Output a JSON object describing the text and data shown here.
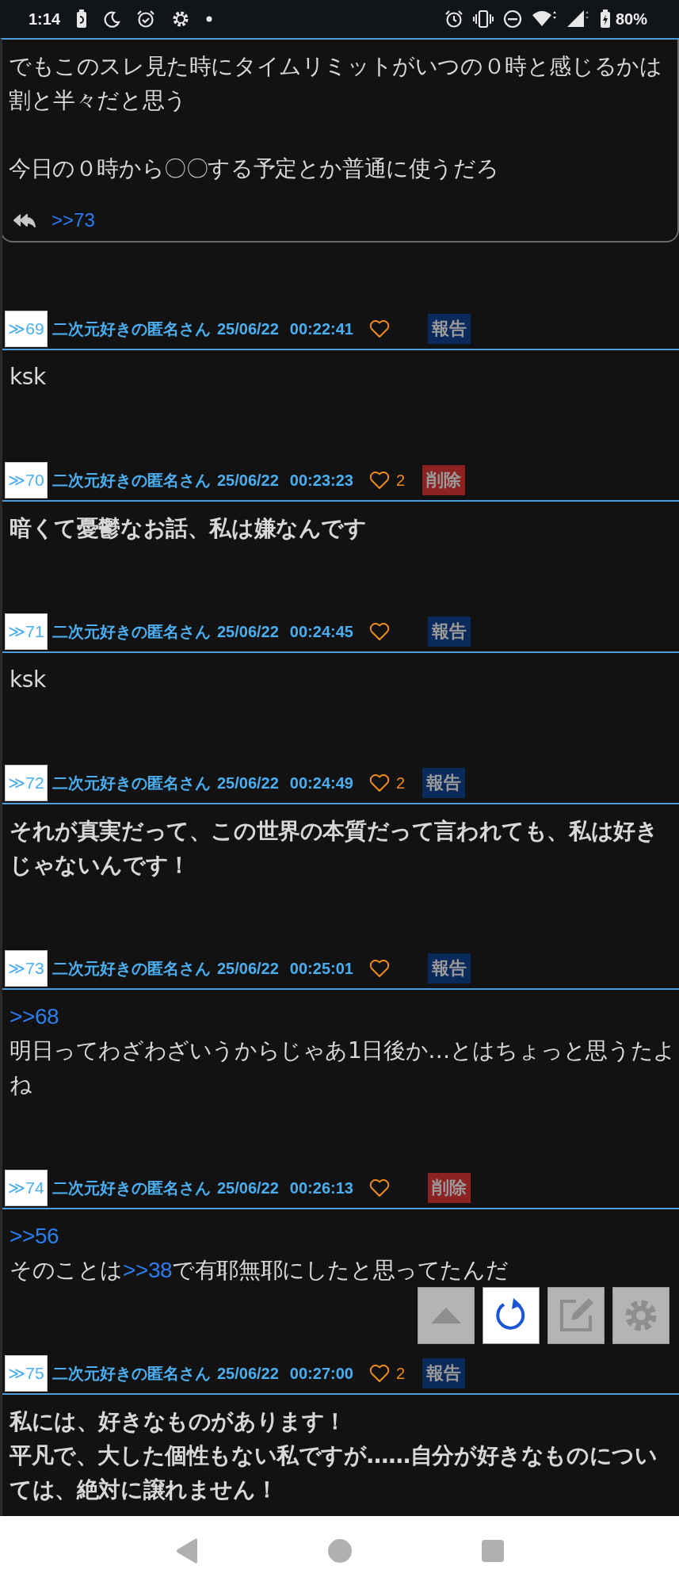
{
  "status_bar": {
    "time": "1:14",
    "battery": "80%"
  },
  "top_post": {
    "spaced": true,
    "paragraphs": [
      [
        {
          "text": "でもこのスレ見た時にタイムリミットがいつの０時と感じるかは割と半々だと思う",
          "link": false
        }
      ],
      [
        {
          "text": "今日の０時から〇〇する予定とか普通に使うだろ",
          "link": false
        }
      ]
    ],
    "replies": [
      ">>73"
    ]
  },
  "posts": [
    {
      "number": "≫69",
      "name": "二次元好きの匿名さん",
      "date": "25/06/22",
      "time": "00:22:41",
      "action": {
        "kind": "report",
        "label": "報告"
      }
    },
    {
      "bold": false,
      "paragraphs": [
        [
          {
            "text": "ksk",
            "link": false
          }
        ]
      ],
      "number": "≫70",
      "name": "二次元好きの匿名さん",
      "date": "25/06/22",
      "time": "00:23:23",
      "likes": "2",
      "action": {
        "kind": "delete",
        "label": "削除"
      }
    },
    {
      "bold": true,
      "paragraphs": [
        [
          {
            "text": "暗くて憂鬱なお話、私は嫌なんです",
            "link": false
          }
        ]
      ],
      "number": "≫71",
      "name": "二次元好きの匿名さん",
      "date": "25/06/22",
      "time": "00:24:45",
      "action": {
        "kind": "report",
        "label": "報告"
      }
    },
    {
      "bold": false,
      "paragraphs": [
        [
          {
            "text": "ksk",
            "link": false
          }
        ]
      ],
      "number": "≫72",
      "name": "二次元好きの匿名さん",
      "date": "25/06/22",
      "time": "00:24:49",
      "likes": "2",
      "action": {
        "kind": "report",
        "label": "報告"
      }
    },
    {
      "bold": true,
      "paragraphs": [
        [
          {
            "text": "それが真実だって、この世界の本質だって言われても、私は好きじゃないんです！",
            "link": false
          }
        ]
      ],
      "number": "≫73",
      "name": "二次元好きの匿名さん",
      "date": "25/06/22",
      "time": "00:25:01",
      "action": {
        "kind": "report",
        "label": "報告"
      }
    },
    {
      "bold": false,
      "paragraphs": [
        [
          {
            "text": ">>68",
            "link": true
          }
        ],
        [
          {
            "text": "明日ってわざわざいうからじゃあ1日後か…とはちょっと思うたよね",
            "link": false
          }
        ]
      ],
      "number": "≫74",
      "name": "二次元好きの匿名さん",
      "date": "25/06/22",
      "time": "00:26:13",
      "action": {
        "kind": "delete",
        "label": "削除"
      }
    },
    {
      "bold": false,
      "paragraphs": [
        [
          {
            "text": ">>56",
            "link": true
          }
        ],
        [
          {
            "text": "そのことは",
            "link": false
          },
          {
            "text": ">>38",
            "link": true
          },
          {
            "text": "で有耶無耶にしたと思ってたんだ",
            "link": false
          }
        ]
      ],
      "number": "≫75",
      "name": "二次元好きの匿名さん",
      "date": "25/06/22",
      "time": "00:27:00",
      "likes": "2",
      "action": {
        "kind": "report",
        "label": "報告"
      }
    },
    {
      "bold": true,
      "paragraphs": [
        [
          {
            "text": "私には、好きなものがあります！",
            "link": false
          }
        ],
        [
          {
            "text": "平凡で、大した個性もない私ですが……自分が好きなものについては、絶対に譲れません！",
            "link": false
          }
        ]
      ]
    }
  ],
  "float_buttons": [
    {
      "kind": "scroll-top",
      "active": false
    },
    {
      "kind": "refresh",
      "active": true
    },
    {
      "kind": "write",
      "active": false
    },
    {
      "kind": "settings",
      "active": false
    }
  ]
}
